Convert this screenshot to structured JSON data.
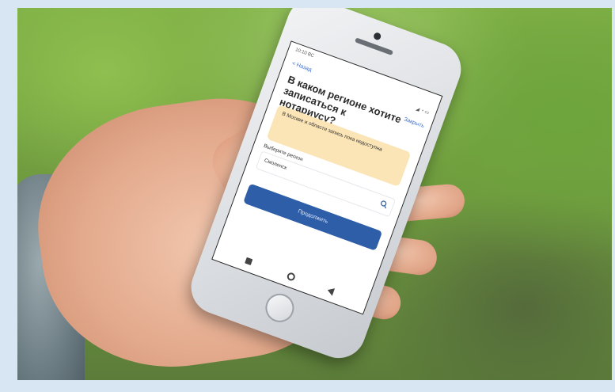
{
  "screen": {
    "status_time": "10:10 ВС",
    "status_icons": "◢ ◔ ▭",
    "back_label": "< Назад",
    "close_label": "Закрыть",
    "title": "В каком регионе хотите записаться к нотариусу?",
    "notice_text": "В Москве и области запись пока недоступна",
    "region_label": "Выберите регион",
    "region_placeholder": "Смоленск",
    "continue_label": "Продолжить"
  },
  "colors": {
    "accent": "#2f5ea8",
    "link": "#3b6fd1",
    "notice_bg": "#fbe4b5"
  },
  "icons": {
    "search": "search-icon",
    "nav_square": "square-icon",
    "nav_home": "circle-icon",
    "nav_back": "triangle-back-icon"
  }
}
